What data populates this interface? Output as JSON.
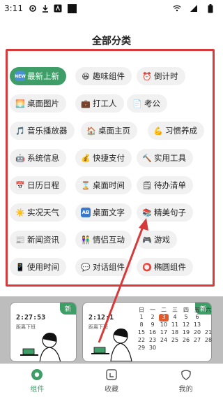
{
  "status_bar": {
    "time": "3:11"
  },
  "sheet": {
    "title": "全部分类"
  },
  "categories": [
    {
      "label": "最新上新",
      "icon": "new-icon",
      "active": true
    },
    {
      "label": "趣味组件",
      "icon": "laugh-emoji-icon"
    },
    {
      "label": "倒计时",
      "icon": "alarm-clock-icon"
    },
    {
      "label": "桌面图片",
      "icon": "sunrise-icon"
    },
    {
      "label": "打工人",
      "icon": "briefcase-icon"
    },
    {
      "label": "考公",
      "icon": "document-icon"
    },
    {
      "label": "音乐播放器",
      "icon": "music-note-icon"
    },
    {
      "label": "桌面主页",
      "icon": "house-icon"
    },
    {
      "label": "习惯养成",
      "icon": "flexed-arm-icon"
    },
    {
      "label": "系统信息",
      "icon": "robot-icon"
    },
    {
      "label": "快捷支付",
      "icon": "money-bag-icon"
    },
    {
      "label": "实用工具",
      "icon": "hammer-icon"
    },
    {
      "label": "日历日程",
      "icon": "calendar-icon"
    },
    {
      "label": "桌面时间",
      "icon": "hourglass-icon"
    },
    {
      "label": "待办清单",
      "icon": "notepad-icon"
    },
    {
      "label": "实况天气",
      "icon": "sun-icon"
    },
    {
      "label": "桌面文字",
      "icon": "letters-icon"
    },
    {
      "label": "精美句子",
      "icon": "books-icon"
    },
    {
      "label": "新闻资讯",
      "icon": "newspaper-icon"
    },
    {
      "label": "情侣互动",
      "icon": "couple-icon"
    },
    {
      "label": "游戏",
      "icon": "gamepad-icon"
    },
    {
      "label": "使用时间",
      "icon": "phone-icon"
    },
    {
      "label": "对话组件",
      "icon": "speech-bubble-icon"
    },
    {
      "label": "椭圆组件",
      "icon": "circle-icon"
    }
  ],
  "preview": {
    "card1": {
      "time": "2:27:53",
      "sub": "距离下班",
      "badge": "新"
    },
    "card2": {
      "time": "2:12:1",
      "sub": "距离下班",
      "badge": "新"
    },
    "calendar": {
      "weekdays": [
        "日",
        "一",
        "二",
        "三",
        "四",
        "五",
        "六"
      ],
      "rows": [
        [
          "1",
          "2",
          "3",
          "4",
          "5",
          "6",
          ""
        ],
        [
          "8",
          "9",
          "10",
          "11",
          "12",
          "13",
          ""
        ],
        [
          "15",
          "16",
          "17",
          "18",
          "19",
          "20",
          "21"
        ],
        [
          "22",
          "23",
          "24",
          "25",
          "26",
          "27",
          "28"
        ],
        [
          "29",
          "30",
          "",
          "",
          "",
          "",
          ""
        ]
      ],
      "highlight": "3"
    }
  },
  "tabs": [
    {
      "label": "组件",
      "active": true
    },
    {
      "label": "收藏"
    },
    {
      "label": "我的"
    }
  ],
  "colors": {
    "accent_green": "#3f9e68",
    "annotation_red": "#d63a3a"
  }
}
